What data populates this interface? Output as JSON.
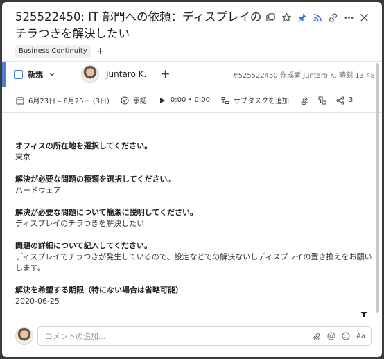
{
  "task": {
    "title": "525522450: IT 部門への依頼：ディスプレイのチラつきを解決したい",
    "tag": "Business Continuity",
    "status": "新規",
    "assignee": "Juntaro K.",
    "meta": "#525522450 作成者 Juntaro K. 時刻 13:48"
  },
  "toolbar": {
    "dates": "6月23日 – 6月25日 (3日)",
    "approve": "承認",
    "timer": "0:00 • 0:00",
    "subtask": "サブタスクを追加",
    "share_count": "3"
  },
  "fields": [
    {
      "q": "オフィスの所在地を選択してください。",
      "a": "東京"
    },
    {
      "q": "解決が必要な問題の種類を選択してください。",
      "a": "ハードウェア"
    },
    {
      "q": "解決が必要な問題について簡潔に説明してください。",
      "a": "ディスプレイのチラつきを解決したい"
    },
    {
      "q": "問題の詳細について記入してください。",
      "a": "ディスプレイでチラつきが発生しているので、設定などでの解決ないしディスプレイの置き換えをお願いします。"
    },
    {
      "q": "解決を希望する期限（特にない場合は省略可能）",
      "a": "2020-06-25"
    }
  ],
  "comment": {
    "placeholder": "コメントの追加...",
    "format_label": "Aa"
  },
  "colors": {
    "accent": "#4a7fd4",
    "pin": "#3d6fd1",
    "rss": "#3d6fd1"
  },
  "icons": [
    "layers-icon",
    "star-icon",
    "pin-icon",
    "rss-icon",
    "link-icon",
    "more-icon",
    "close-icon"
  ]
}
